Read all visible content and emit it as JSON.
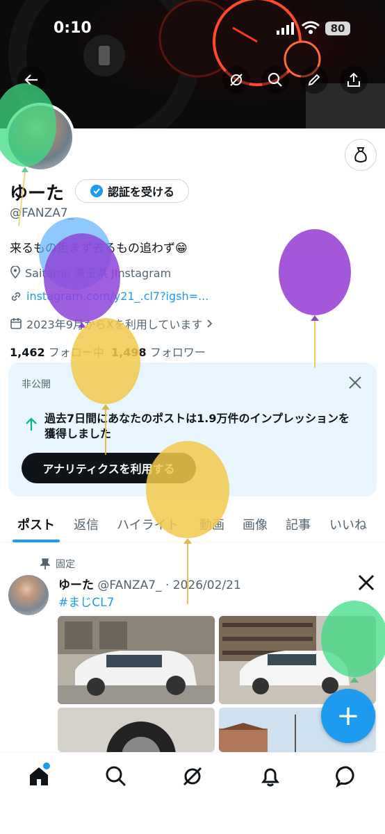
{
  "status_bar": {
    "time": "0:10",
    "battery": "80"
  },
  "profile": {
    "display_name": "ゆーた",
    "verify_label": "認証を受ける",
    "handle": "@FANZA7_",
    "bio": "来るもの拒まず去るもの追わず😁",
    "location": "Saitama 埼玉県 JInstagram",
    "website": "instagram.com/y21_.cl7?igsh=...",
    "joined": "2023年9月からXを利用しています",
    "following_count": "1,462",
    "following_label": "フォロー中",
    "followers_count": "1,498",
    "followers_label": "フォロワー"
  },
  "analytics_card": {
    "badge": "非公開",
    "message": "過去7日間にあなたのポストは1.9万件のインプレッションを獲得しました",
    "button_label": "アナリティクスを利用する"
  },
  "tabs": [
    "ポスト",
    "返信",
    "ハイライト",
    "動画",
    "画像",
    "記事",
    "いいね"
  ],
  "pinned_post": {
    "pinned_label": "固定",
    "author_name": "ゆーた",
    "author_handle": "@FANZA7_",
    "date": "· 2026/02/21",
    "hashtag": "#まじCL7"
  },
  "fab_label": "+",
  "icons": {
    "back": "back-arrow-icon",
    "grok": "grok-icon",
    "search": "search-icon",
    "edit": "pencil-icon",
    "share": "share-icon",
    "tip": "money-bag-icon",
    "x_logo": "x-logo-icon",
    "nav": [
      "home-icon",
      "search-icon",
      "grok-icon",
      "bell-icon",
      "chat-icon"
    ]
  },
  "colors": {
    "accent": "#1d9bf0",
    "card_bg": "#eaf6ff",
    "text": "#0f1419",
    "muted": "#536471"
  }
}
